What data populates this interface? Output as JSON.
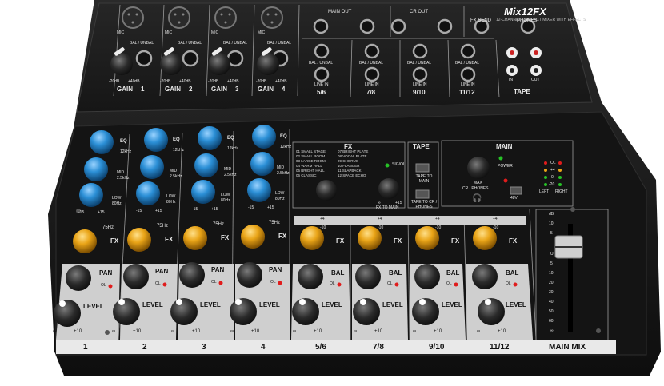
{
  "brand": {
    "model": "Mix12FX",
    "tagline": "12-CHANNEL COMPACT MIXER WITH EFFECTS"
  },
  "rear_panel": {
    "mono_channels": [
      {
        "mic_label": "MIC",
        "line_label": "BAL / UNBAL",
        "gain_label": "GAIN",
        "number": "1",
        "min": "-20dB",
        "max": "+40dB"
      },
      {
        "mic_label": "MIC",
        "line_label": "BAL / UNBAL",
        "gain_label": "GAIN",
        "number": "2",
        "min": "-20dB",
        "max": "+40dB"
      },
      {
        "mic_label": "MIC",
        "line_label": "BAL / UNBAL",
        "gain_label": "GAIN",
        "number": "3",
        "min": "-20dB",
        "max": "+40dB"
      },
      {
        "mic_label": "MIC",
        "line_label": "BAL / UNBAL",
        "gain_label": "GAIN",
        "number": "4",
        "min": "-20dB",
        "max": "+40dB"
      }
    ],
    "outputs": {
      "main_out": "MAIN OUT",
      "cr_out": "CR OUT",
      "fx_send": "FX SEND",
      "phones": "PHONES",
      "l": "L",
      "r": "R"
    },
    "stereo_inputs": [
      {
        "label": "BAL / UNBAL",
        "line_in": "LINE IN",
        "number": "5/6"
      },
      {
        "label": "BAL / UNBAL",
        "line_in": "LINE IN",
        "number": "7/8"
      },
      {
        "label": "BAL / UNBAL",
        "line_in": "LINE IN",
        "number": "9/10"
      },
      {
        "label": "BAL / UNBAL",
        "line_in": "LINE IN",
        "number": "11/12"
      }
    ],
    "tape": {
      "label": "TAPE",
      "in": "IN",
      "out": "OUT"
    }
  },
  "mono_strip": {
    "eq_label": "EQ",
    "hi_label": "HI",
    "hi_freq": "12kHz",
    "mid_label": "MID",
    "mid_freq": "2.5kHz",
    "low_label": "LOW",
    "low_freq": "80Hz",
    "range_min": "-15",
    "range_max": "+15",
    "hpf": "75Hz",
    "fx_label": "FX",
    "pan_label": "PAN",
    "ol_label": "OL",
    "level_label": "LEVEL",
    "level_min": "∞",
    "level_max": "+10",
    "channel_numbers": [
      "1",
      "2",
      "3",
      "4"
    ]
  },
  "stereo_strip": {
    "plus4": "+4",
    "minus10": "-10",
    "fx_label": "FX",
    "bal_label": "BAL",
    "ol_label": "OL",
    "level_label": "LEVEL",
    "level_min": "∞",
    "level_max": "+10",
    "channel_numbers": [
      "5/6",
      "7/8",
      "9/10",
      "11/12"
    ]
  },
  "fx_section": {
    "header": "FX",
    "presets_left": [
      "01 SMALL STAGE",
      "02 SMALL ROOM",
      "03 LARGE ROOM",
      "04 WARM HALL",
      "05 BRIGHT HALL",
      "06 CLASSIC"
    ],
    "presets_right": [
      "07 BRIGHT PLATE",
      "08 VOCAL PLATE",
      "09 CHORUS",
      "10 FLANGER",
      "11 SLAPBACK",
      "12 SPACE ECHO"
    ],
    "sig_ol": "SIG/OL",
    "fx_to_main": "FX TO MAIN",
    "min": "∞",
    "max": "+15"
  },
  "tape_section": {
    "header": "TAPE",
    "to_main": "TAPE TO MAIN",
    "to_cr": "TAPE TO CR / PHONES"
  },
  "main_section": {
    "header": "MAIN",
    "power": "POWER",
    "phantom": "48V",
    "cr_phones": "CR / PHONES",
    "max": "MAX",
    "meter_labels": [
      "OL",
      "+4",
      "0",
      "-20"
    ],
    "left": "LEFT",
    "right": "RIGHT",
    "fader_scale": [
      "dB",
      "10",
      "5",
      "U",
      "5",
      "10",
      "20",
      "30",
      "40",
      "50",
      "60",
      "∞"
    ],
    "main_mix": "MAIN MIX"
  },
  "colors": {
    "eq_knob": "#2b8fd6",
    "fx_knob": "#e9a417",
    "ol_led": "#e01c1c",
    "sig_led": "#27c227",
    "body": "#1a1a1a",
    "panel": "#cfcfcf"
  }
}
